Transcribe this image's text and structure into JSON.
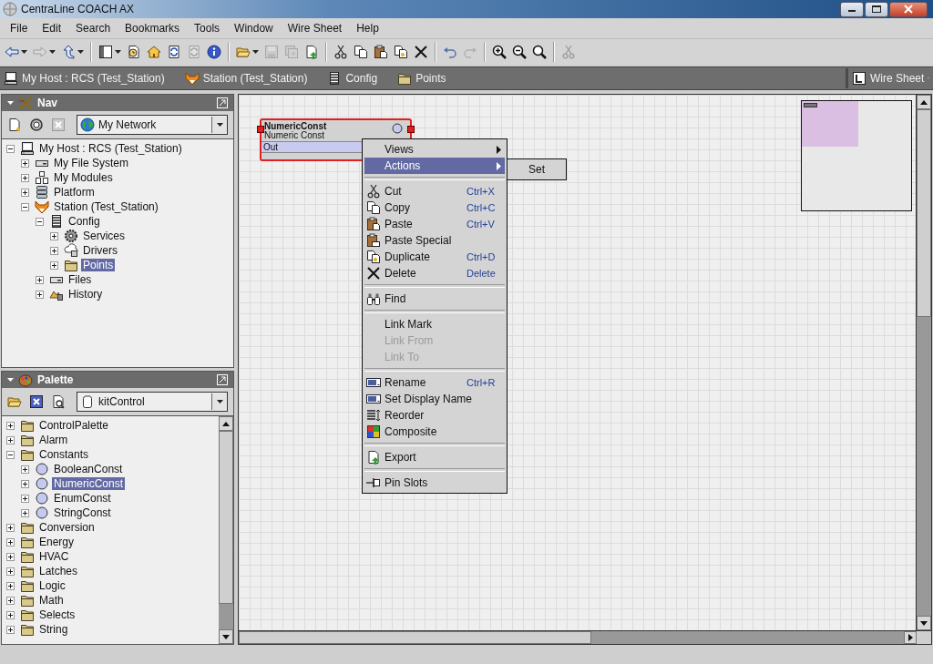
{
  "window": {
    "title": "CentraLine COACH AX"
  },
  "menu_bar": [
    "File",
    "Edit",
    "Search",
    "Bookmarks",
    "Tools",
    "Window",
    "Wire Sheet",
    "Help"
  ],
  "toolbar": [
    {
      "kind": "back",
      "disabled": false,
      "dropdown": true
    },
    {
      "kind": "forward",
      "disabled": true,
      "dropdown": true
    },
    {
      "kind": "up",
      "disabled": false,
      "dropdown": true
    },
    {
      "kind": "separator"
    },
    {
      "kind": "sidebar",
      "disabled": false,
      "dropdown": true
    },
    {
      "kind": "clock",
      "disabled": false,
      "dropdown": false
    },
    {
      "kind": "home",
      "disabled": false,
      "dropdown": false
    },
    {
      "kind": "refresh",
      "disabled": false,
      "dropdown": false
    },
    {
      "kind": "refresh",
      "disabled": true,
      "dropdown": false
    },
    {
      "kind": "info",
      "disabled": false,
      "dropdown": false
    },
    {
      "kind": "separator"
    },
    {
      "kind": "open",
      "disabled": false,
      "dropdown": true
    },
    {
      "kind": "save",
      "disabled": true,
      "dropdown": false
    },
    {
      "kind": "saveall",
      "disabled": true,
      "dropdown": false
    },
    {
      "kind": "newdoc",
      "disabled": false,
      "dropdown": false
    },
    {
      "kind": "separator"
    },
    {
      "kind": "cut",
      "disabled": false,
      "dropdown": false
    },
    {
      "kind": "copy",
      "disabled": false,
      "dropdown": false
    },
    {
      "kind": "paste",
      "disabled": false,
      "dropdown": false
    },
    {
      "kind": "duplicate",
      "disabled": false,
      "dropdown": false
    },
    {
      "kind": "delete",
      "disabled": false,
      "dropdown": false
    },
    {
      "kind": "separator"
    },
    {
      "kind": "undo",
      "disabled": false,
      "dropdown": false
    },
    {
      "kind": "redo",
      "disabled": true,
      "dropdown": false
    },
    {
      "kind": "separator"
    },
    {
      "kind": "zoomin",
      "disabled": false,
      "dropdown": false
    },
    {
      "kind": "zoomout",
      "disabled": false,
      "dropdown": false
    },
    {
      "kind": "zoom",
      "disabled": false,
      "dropdown": false
    },
    {
      "kind": "separator"
    },
    {
      "kind": "cut",
      "disabled": true,
      "dropdown": false
    }
  ],
  "breadcrumb": [
    {
      "kind": "host",
      "label": "My Host : RCS (Test_Station)"
    },
    {
      "kind": "station",
      "label": "Station (Test_Station)"
    },
    {
      "kind": "config",
      "label": "Config"
    },
    {
      "kind": "folder",
      "label": "Points"
    }
  ],
  "view_selector": {
    "label": "Wire Sheet"
  },
  "nav": {
    "title": "Nav",
    "network": "My Network",
    "tree": [
      {
        "kind": "host",
        "label": "My Host : RCS (Test_Station)",
        "expanded": true,
        "selected": false,
        "children": [
          {
            "kind": "drive",
            "label": "My File System",
            "expanded": false,
            "selected": false
          },
          {
            "kind": "modules",
            "label": "My Modules",
            "expanded": false,
            "selected": false
          },
          {
            "kind": "platform",
            "label": "Platform",
            "expanded": false,
            "selected": false
          },
          {
            "kind": "station",
            "label": "Station (Test_Station)",
            "expanded": true,
            "selected": false,
            "children": [
              {
                "kind": "config",
                "label": "Config",
                "expanded": true,
                "selected": false,
                "children": [
                  {
                    "kind": "gears",
                    "label": "Services",
                    "expanded": false,
                    "selected": false
                  },
                  {
                    "kind": "drivers",
                    "label": "Drivers",
                    "expanded": false,
                    "selected": false
                  },
                  {
                    "kind": "folder",
                    "label": "Points",
                    "expanded": false,
                    "selected": true
                  }
                ]
              },
              {
                "kind": "drive",
                "label": "Files",
                "expanded": false,
                "selected": false
              },
              {
                "kind": "history",
                "label": "History",
                "expanded": false,
                "selected": false
              }
            ]
          }
        ]
      }
    ]
  },
  "palette": {
    "title": "Palette",
    "module": "kitControl",
    "tree": [
      {
        "kind": "folder",
        "label": "ControlPalette",
        "expanded": false,
        "selected": false
      },
      {
        "kind": "folder",
        "label": "Alarm",
        "expanded": false,
        "selected": false
      },
      {
        "kind": "folder",
        "label": "Constants",
        "expanded": true,
        "selected": false,
        "children": [
          {
            "kind": "const",
            "label": "BooleanConst",
            "expanded": false,
            "selected": false
          },
          {
            "kind": "const",
            "label": "NumericConst",
            "expanded": false,
            "selected": true
          },
          {
            "kind": "const",
            "label": "EnumConst",
            "expanded": false,
            "selected": false
          },
          {
            "kind": "const",
            "label": "StringConst",
            "expanded": false,
            "selected": false
          }
        ]
      },
      {
        "kind": "folder",
        "label": "Conversion",
        "expanded": false,
        "selected": false
      },
      {
        "kind": "folder",
        "label": "Energy",
        "expanded": false,
        "selected": false
      },
      {
        "kind": "folder",
        "label": "HVAC",
        "expanded": false,
        "selected": false
      },
      {
        "kind": "folder",
        "label": "Latches",
        "expanded": false,
        "selected": false
      },
      {
        "kind": "folder",
        "label": "Logic",
        "expanded": false,
        "selected": false
      },
      {
        "kind": "folder",
        "label": "Math",
        "expanded": false,
        "selected": false
      },
      {
        "kind": "folder",
        "label": "Selects",
        "expanded": false,
        "selected": false
      },
      {
        "kind": "folder",
        "label": "String",
        "expanded": false,
        "selected": false
      }
    ]
  },
  "wire_sheet": {
    "node": {
      "name": "NumericConst",
      "type": "Numeric Const",
      "slot": "Out",
      "selected": true
    },
    "context_menu": [
      {
        "kind": "plain",
        "label": "Views",
        "disabled": false,
        "selected": false,
        "submenu": true
      },
      {
        "kind": "plain",
        "label": "Actions",
        "disabled": false,
        "selected": true,
        "submenu": true
      },
      {
        "kind": "separator"
      },
      {
        "kind": "cut",
        "label": "Cut",
        "shortcut": "Ctrl+X",
        "disabled": false,
        "selected": false,
        "submenu": false
      },
      {
        "kind": "copy",
        "label": "Copy",
        "shortcut": "Ctrl+C",
        "disabled": false,
        "selected": false,
        "submenu": false
      },
      {
        "kind": "paste",
        "label": "Paste",
        "shortcut": "Ctrl+V",
        "disabled": false,
        "selected": false,
        "submenu": false
      },
      {
        "kind": "pastespecial",
        "label": "Paste Special",
        "disabled": false,
        "selected": false,
        "submenu": false
      },
      {
        "kind": "duplicate",
        "label": "Duplicate",
        "shortcut": "Ctrl+D",
        "disabled": false,
        "selected": false,
        "submenu": false
      },
      {
        "kind": "delete",
        "label": "Delete",
        "shortcut": "Delete",
        "disabled": false,
        "selected": false,
        "submenu": false
      },
      {
        "kind": "separator"
      },
      {
        "kind": "find",
        "label": "Find",
        "disabled": false,
        "selected": false,
        "submenu": false
      },
      {
        "kind": "separator"
      },
      {
        "kind": "plain",
        "label": "Link Mark",
        "disabled": false,
        "selected": false,
        "submenu": false
      },
      {
        "kind": "plain",
        "label": "Link From",
        "disabled": true,
        "selected": false,
        "submenu": false
      },
      {
        "kind": "plain",
        "label": "Link To",
        "disabled": true,
        "selected": false,
        "submenu": false
      },
      {
        "kind": "separator"
      },
      {
        "kind": "rename",
        "label": "Rename",
        "shortcut": "Ctrl+R",
        "disabled": false,
        "selected": false,
        "submenu": false
      },
      {
        "kind": "rename",
        "label": "Set Display Name",
        "disabled": false,
        "selected": false,
        "submenu": false
      },
      {
        "kind": "reorder",
        "label": "Reorder",
        "disabled": false,
        "selected": false,
        "submenu": false
      },
      {
        "kind": "composite",
        "label": "Composite",
        "disabled": false,
        "selected": false,
        "submenu": false
      },
      {
        "kind": "separator"
      },
      {
        "kind": "export",
        "label": "Export",
        "disabled": false,
        "selected": false,
        "submenu": false
      },
      {
        "kind": "separator"
      },
      {
        "kind": "pin",
        "label": "Pin Slots",
        "disabled": false,
        "selected": false,
        "submenu": false
      }
    ],
    "submenu": [
      {
        "label": "Set"
      }
    ]
  }
}
